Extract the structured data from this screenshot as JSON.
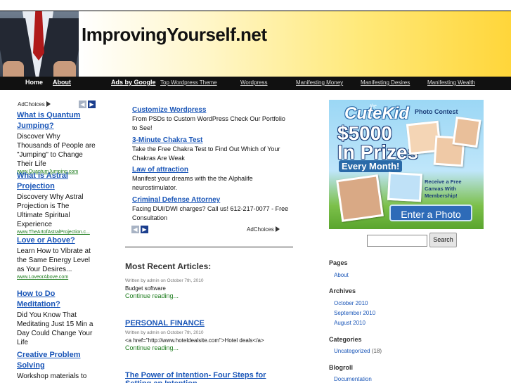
{
  "site": {
    "title": "ImprovingYourself.net"
  },
  "nav": {
    "home": "Home",
    "about": "About",
    "ads_by": "Ads by Google",
    "links": [
      "Top Wordpress Theme",
      "Wordpress",
      "Manifesting Money",
      "Manifesting Desires",
      "Manifesting Wealth"
    ]
  },
  "left_ads": {
    "adchoices": "AdChoices",
    "items": [
      {
        "title": "What is Quantum Jumping?",
        "desc": "Discover Why Thousands of People are \"Jumping\" to Change Their Life",
        "url": "www.QuantumJumping.com"
      },
      {
        "title": "What is Astral Projection",
        "desc": "Discovery Why Astral Projection is The Ultimate Spiritual Experience",
        "url": "www.TheArtofAstralProjection.c..."
      },
      {
        "title": "Love or Above?",
        "desc": "Learn How to Vibrate at the Same Energy Level as Your Desires...",
        "url": "www.LoveorAbove.com"
      },
      {
        "title": "How to Do Meditation?",
        "desc": "Did You Know That Meditating Just 15 Min a Day Could Change Your Life",
        "url": ""
      },
      {
        "title": "Creative Problem Solving",
        "desc": "Workshop materials to",
        "url": ""
      }
    ]
  },
  "center_ads": {
    "adchoices": "AdChoices",
    "items": [
      {
        "title": "Customize Wordpress",
        "desc": "From PSDs to Custom WordPress Check Our Portfolio to See!"
      },
      {
        "title": "3-Minute Chakra Test",
        "desc": "Take the Free Chakra Test to Find Out Which of Your Chakras Are Weak"
      },
      {
        "title": "Law of attraction",
        "desc": "Manifest your dreams with the the Alphalife neurostimulator."
      },
      {
        "title": "Criminal Defense Attorney",
        "desc": "Facing DUI/DWI charges? Call us! 612-217-0077 - Free Consultation"
      }
    ]
  },
  "articles": {
    "heading": "Most Recent Articles:",
    "posts": [
      {
        "title": "",
        "meta": "Written by admin on October 7th, 2010",
        "body": "Budget software",
        "more": "Continue reading..."
      },
      {
        "title": "PERSONAL FINANCE",
        "meta": "Written by admin on October 7th, 2010",
        "body": "<a href=\"http://www.hoteldealsite.com\">Hotel deals</a>",
        "more": "Continue reading..."
      },
      {
        "title": "The Power of Intention- Four Steps for Setting an Intention",
        "meta": "",
        "body": "",
        "more": ""
      }
    ]
  },
  "promo": {
    "the": "the",
    "brand": "CuteKid",
    "contest": "Photo Contest",
    "amount_line1": "$5000",
    "amount_line2": "In Prizes",
    "every_month": "Every Month!",
    "receive": "Receive a Free Canvas With Membership!",
    "enter": "Enter a Photo"
  },
  "search": {
    "button": "Search",
    "value": ""
  },
  "sidebar": {
    "pages_h": "Pages",
    "pages": [
      "About"
    ],
    "archives_h": "Archives",
    "archives": [
      "October 2010",
      "September 2010",
      "August 2010"
    ],
    "categories_h": "Categories",
    "category": "Uncategorized",
    "category_count": "(18)",
    "blogroll_h": "Blogroll",
    "blogroll": [
      "Documentation"
    ]
  },
  "colors": {
    "link": "#1a56b8",
    "url_green": "#1a7a1a",
    "nav_bg": "#111111"
  }
}
